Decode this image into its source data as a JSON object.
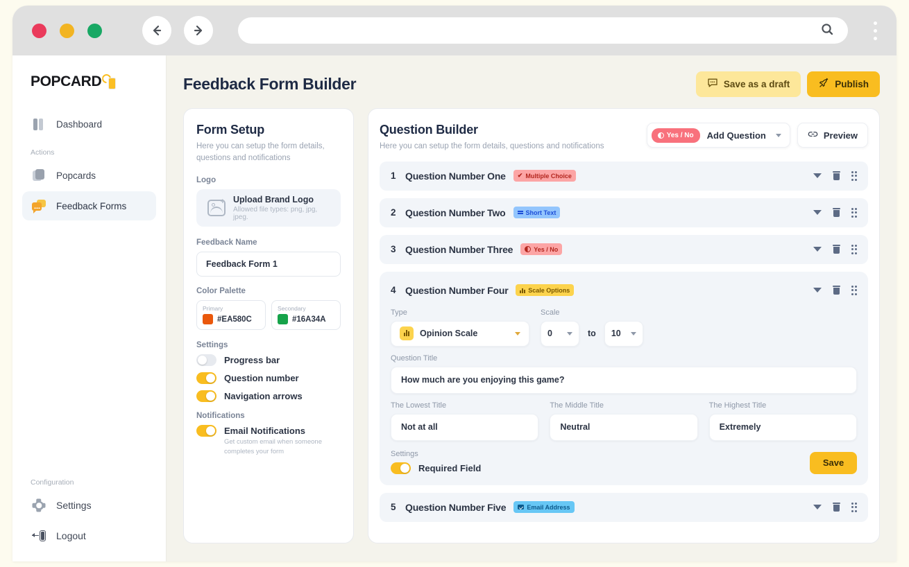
{
  "browser": {
    "dots": [
      "red",
      "yellow",
      "green"
    ],
    "back_icon": "arrow-left-icon",
    "forward_icon": "arrow-right-icon",
    "url_value": "",
    "url_placeholder": "",
    "search_icon": "search-icon",
    "menu_icon": "kebab-menu-icon"
  },
  "sidebar": {
    "logo_text": "POPCARD",
    "items": [
      {
        "label": "Dashboard",
        "icon": "dashboard-icon",
        "active": false
      },
      {
        "label": "Popcards",
        "icon": "cards-icon",
        "active": false
      },
      {
        "label": "Feedback Forms",
        "icon": "chat-bubble-icon",
        "active": true
      }
    ],
    "group_actions": "Actions",
    "group_configuration": "Configuration",
    "bottom_items": [
      {
        "label": "Settings",
        "icon": "gear-icon"
      },
      {
        "label": "Logout",
        "icon": "logout-icon"
      }
    ]
  },
  "header": {
    "title": "Feedback Form Builder",
    "save_draft_label": "Save as a draft",
    "save_draft_icon": "chat-dots-icon",
    "publish_label": "Publish",
    "publish_icon": "rocket-icon"
  },
  "form_setup": {
    "title": "Form Setup",
    "subtitle": "Here you can setup the form details, questions and notifications",
    "logo_label": "Logo",
    "upload_title": "Upload Brand Logo",
    "upload_hint": "Allowed file types: png, jpg, jpeg.",
    "upload_icon": "image-upload-icon",
    "feedback_name_label": "Feedback Name",
    "feedback_name_value": "Feedback Form 1",
    "feedback_name_placeholder": "Feedback Form 1",
    "color_palette_label": "Color Palette",
    "primary_label": "Primary",
    "primary_hex": "#EA580C",
    "secondary_label": "Secondary",
    "secondary_hex": "#16A34A",
    "settings_label": "Settings",
    "settings": [
      {
        "label": "Progress bar",
        "on": false
      },
      {
        "label": "Question number",
        "on": true
      },
      {
        "label": "Navigation arrows",
        "on": true
      }
    ],
    "notifications_label": "Notifications",
    "notification": {
      "label": "Email Notifications",
      "description": "Get custom email when someone completes your form",
      "on": true
    }
  },
  "question_builder": {
    "title": "Question Builder",
    "subtitle": "Here you can setup the form details, questions and notifications",
    "selected_type_badge": "Yes / No",
    "add_question_label": "Add Question",
    "add_question_chevron": "chevron-down-icon",
    "preview_label": "Preview",
    "preview_icon": "link-icon",
    "row_icons": {
      "collapse": "caret-down-icon",
      "delete": "trash-icon",
      "drag": "drag-handle-icon"
    },
    "questions": [
      {
        "number": "1",
        "name": "Question Number One",
        "badge": "Multiple Choice",
        "badge_style": "mc",
        "badge_icon": "check-icon",
        "expanded": false
      },
      {
        "number": "2",
        "name": "Question Number Two",
        "badge": "Short Text",
        "badge_style": "st",
        "badge_icon": "lines-icon",
        "expanded": false
      },
      {
        "number": "3",
        "name": "Question Number Three",
        "badge": "Yes / No",
        "badge_style": "yn",
        "badge_icon": "half-circle-icon",
        "expanded": false
      },
      {
        "number": "4",
        "name": "Question Number Four",
        "badge": "Scale Options",
        "badge_style": "sc",
        "badge_icon": "bar-chart-icon",
        "expanded": true
      },
      {
        "number": "5",
        "name": "Question Number Five",
        "badge": "Email Address",
        "badge_style": "em",
        "badge_icon": "mail-icon",
        "expanded": false
      }
    ],
    "expanded_question": {
      "type_label": "Type",
      "type_value": "Opinion Scale",
      "type_icon": "bar-chart-icon",
      "scale_label": "Scale",
      "scale_from": "0",
      "scale_to_word": "to",
      "scale_to": "10",
      "question_title_label": "Question Title",
      "question_title_value": "How much are you enjoying this game?",
      "lowest_title_label": "The Lowest Title",
      "lowest_title_value": "Not at all",
      "middle_title_label": "The Middle Title",
      "middle_title_value": "Neutral",
      "highest_title_label": "The Highest Title",
      "highest_title_value": "Extremely",
      "settings_label": "Settings",
      "required_field_label": "Required Field",
      "required_field_on": true,
      "save_label": "Save"
    }
  },
  "colors": {
    "brand_yellow": "#F9BD20",
    "brand_yellow_light": "#FDE79A",
    "page_bg": "#F4F3EC",
    "outer_bg": "#FDFBEF",
    "row_bg": "#F2F5F9",
    "title": "#1E2A44"
  }
}
